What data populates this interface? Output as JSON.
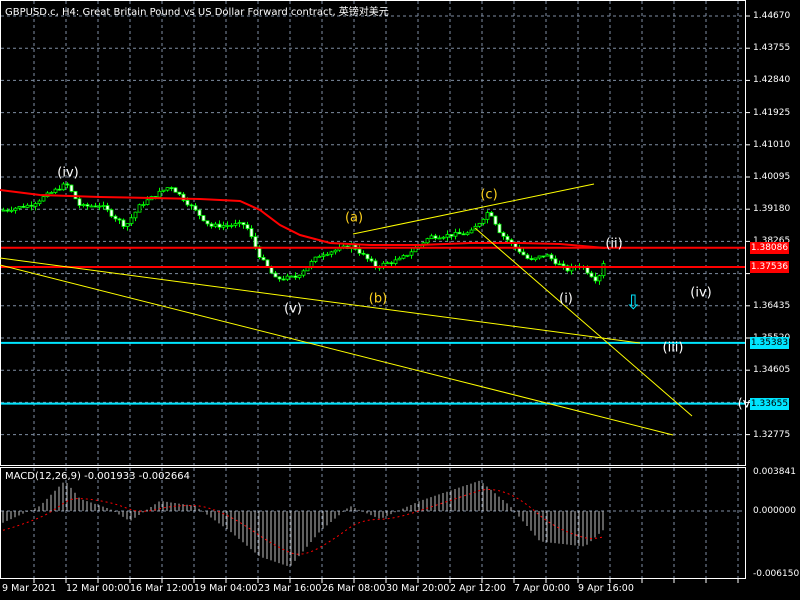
{
  "chart": {
    "title": "GBPUSD.c, H4:  Great Britain Pound vs US Dollar Forward contract, 英镑对美元",
    "price_labels": [
      "1.44670",
      "1.43755",
      "1.42840",
      "1.41925",
      "1.41010",
      "1.40095",
      "1.39180",
      "1.38265",
      "1.36435",
      "1.35520",
      "1.34605",
      "1.32775"
    ],
    "price_tags": [
      {
        "value": "1.38086",
        "color": "#ff0000",
        "text_color": "#ffffff"
      },
      {
        "value": "1.37536",
        "color": "#ff0000",
        "text_color": "#ffffff"
      },
      {
        "value": "1.35383",
        "color": "#00e5ff",
        "text_color": "#000000"
      },
      {
        "value": "1.33655",
        "color": "#00e5ff",
        "text_color": "#000000"
      }
    ],
    "time_labels": [
      "9 Mar 2021",
      "12 Mar 00:00",
      "16 Mar 12:00",
      "19 Mar 04:00",
      "23 Mar 16:00",
      "26 Mar 08:00",
      "30 Mar 20:00",
      "2 Apr 12:00",
      "7 Apr 00:00",
      "9 Apr 16:00"
    ],
    "wave_labels": [
      {
        "text": "(iv)",
        "color": "white"
      },
      {
        "text": "(v)",
        "color": "white"
      },
      {
        "text": "(a)",
        "color": "yellow"
      },
      {
        "text": "(b)",
        "color": "yellow"
      },
      {
        "text": "(c)",
        "color": "yellow"
      },
      {
        "text": "(i)",
        "color": "white"
      },
      {
        "text": "(ii)",
        "color": "white"
      },
      {
        "text": "(iii)",
        "color": "white"
      },
      {
        "text": "(iv)",
        "color": "white"
      },
      {
        "text": "(v",
        "color": "white"
      }
    ],
    "arrow_icon": "down-arrow"
  },
  "macd": {
    "title": "MACD(12,26,9) -0.001933 -0.002664",
    "labels": [
      "0.003841",
      "0.000000",
      "-0.006150"
    ]
  },
  "colors": {
    "bull": "#00ff00",
    "ma": "#ff0000",
    "trend": "#ffff00",
    "level": "#00e5ff",
    "grid": "#7f8ea3"
  }
}
